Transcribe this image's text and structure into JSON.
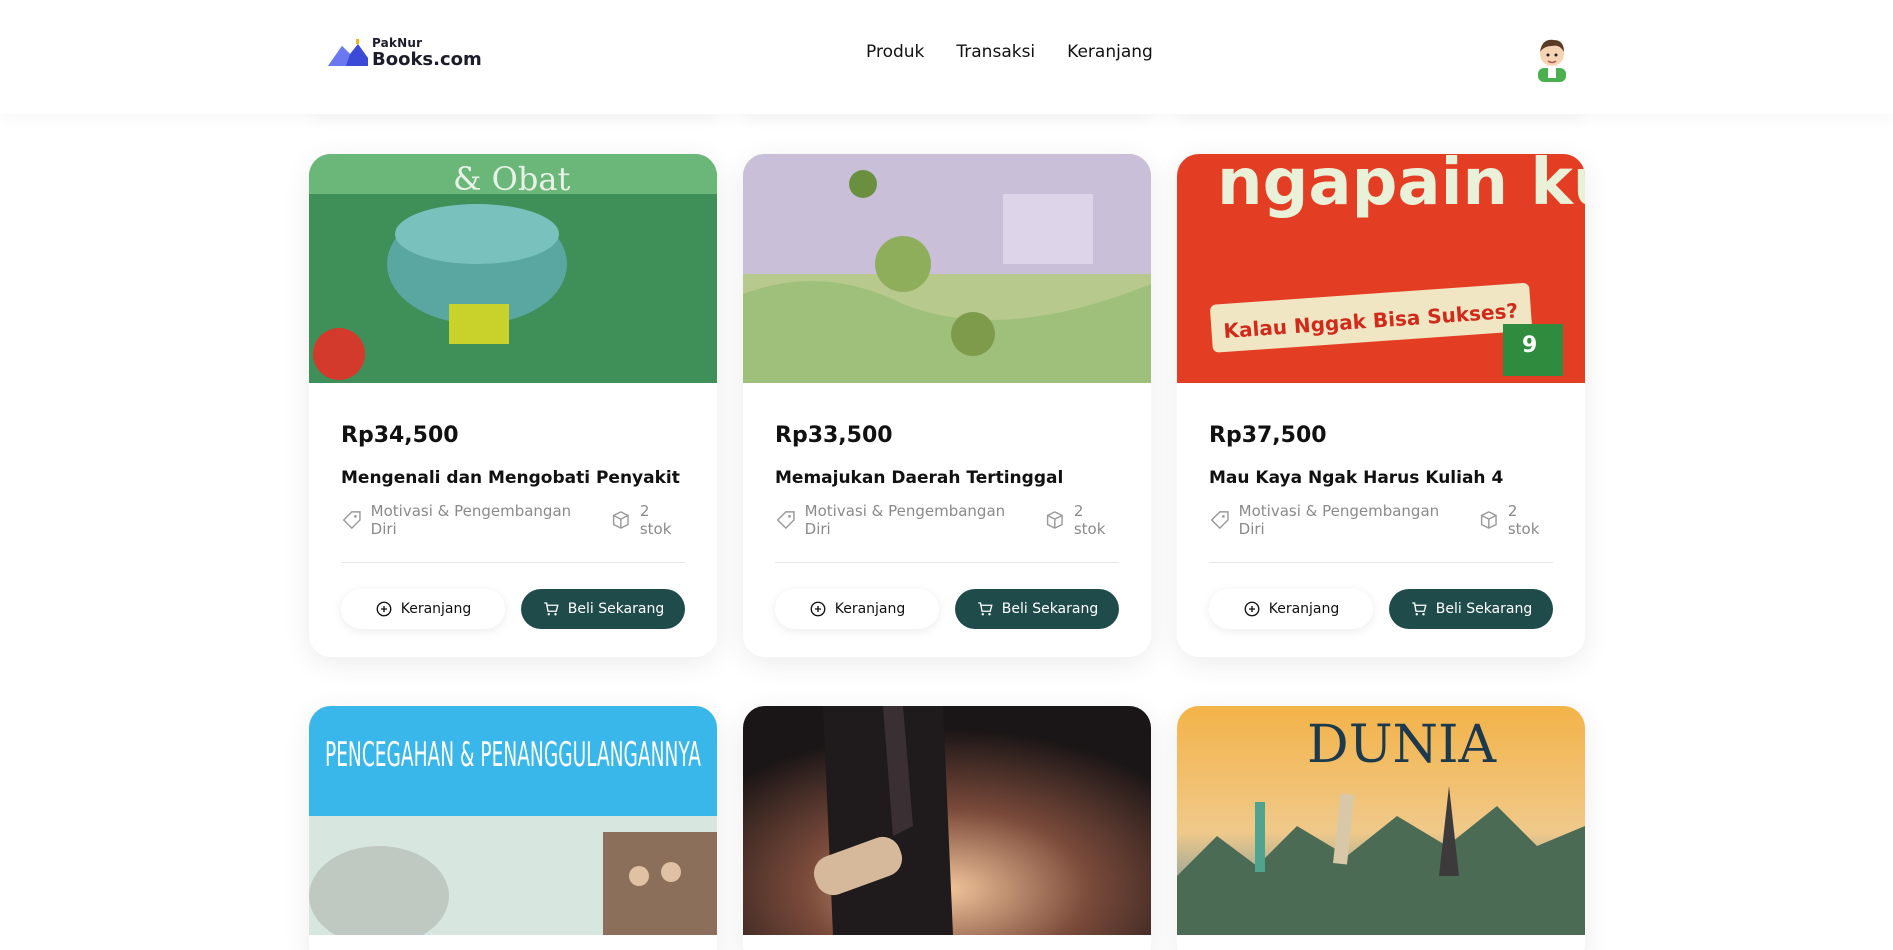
{
  "brand": {
    "small": "PakNur",
    "big": "Books.com"
  },
  "nav": [
    {
      "label": "Produk"
    },
    {
      "label": "Transaksi"
    },
    {
      "label": "Keranjang"
    }
  ],
  "buttons": {
    "cart": "Keranjang",
    "buy": "Beli Sekarang"
  },
  "products": [
    {
      "price": "Rp34,500",
      "title": "Mengenali dan Mengobati Penyakit",
      "category": "Motivasi & Pengembangan Diri",
      "stock": "2 stok",
      "cover_text": "& Obat",
      "cover_colors": [
        "#3f8f58",
        "#7cc392"
      ]
    },
    {
      "price": "Rp33,500",
      "title": "Memajukan Daerah Tertinggal",
      "category": "Motivasi & Pengembangan Diri",
      "stock": "2 stok",
      "cover_text": "",
      "cover_colors": [
        "#9fc27a",
        "#d2c7e2"
      ]
    },
    {
      "price": "Rp37,500",
      "title": "Mau Kaya Ngak Harus Kuliah 4",
      "category": "Motivasi & Pengembangan Diri",
      "stock": "2 stok",
      "cover_text": "ngapain kuliah",
      "cover_subtext": "Kalau Nggak Bisa Sukses?",
      "cover_colors": [
        "#e33d23",
        "#c7321d"
      ]
    },
    {
      "price": "",
      "title": "",
      "category": "",
      "stock": "",
      "cover_text": "PENCEGAHAN & PENANGGULANGANNYA",
      "cover_colors": [
        "#39b6ea",
        "#d8e8e0"
      ]
    },
    {
      "price": "",
      "title": "",
      "category": "",
      "stock": "",
      "cover_text": "",
      "cover_colors": [
        "#2a2220",
        "#d9a380"
      ]
    },
    {
      "price": "",
      "title": "",
      "category": "",
      "stock": "",
      "cover_text": "DUNIA",
      "cover_colors": [
        "#f3b348",
        "#3e84a6"
      ]
    }
  ],
  "colors": {
    "primary": "#1f4b4b",
    "muted": "#8a8a8a",
    "logo_blue": "#3b4bd8"
  }
}
